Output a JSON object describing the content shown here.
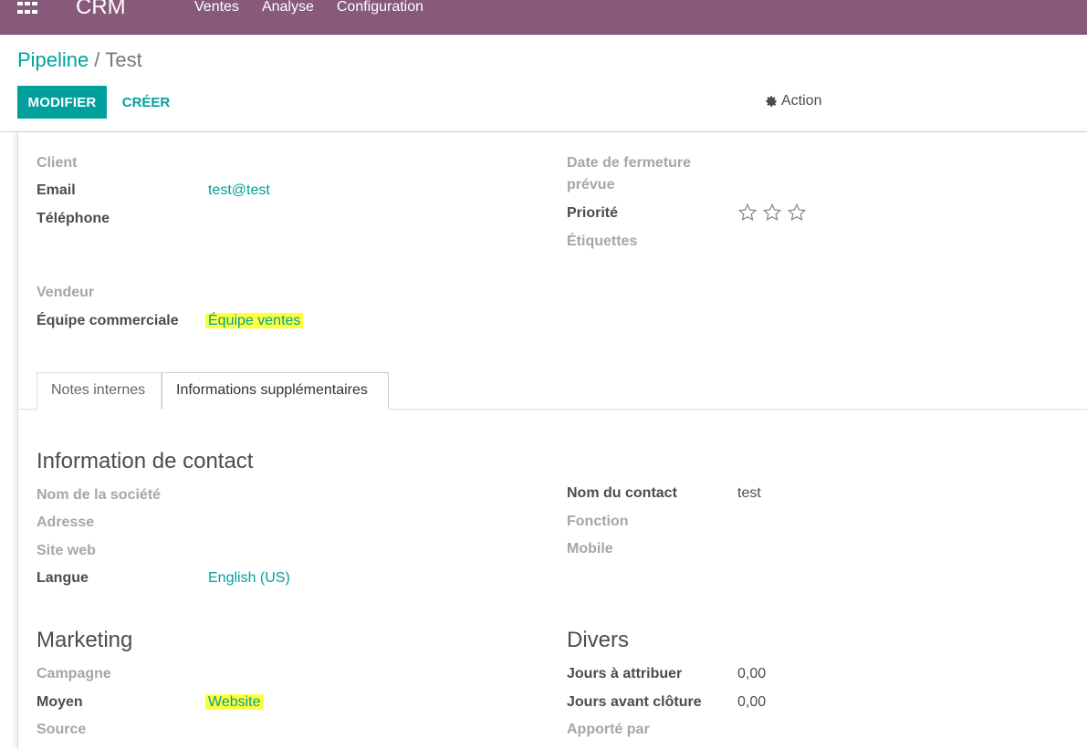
{
  "navbar": {
    "brand": "CRM",
    "menu": [
      "Ventes",
      "Analyse",
      "Configuration"
    ]
  },
  "breadcrumb": {
    "parent": "Pipeline",
    "separator": "/",
    "current": "Test"
  },
  "buttons": {
    "edit": "MODIFIER",
    "create": "CRÉER",
    "action": "Action"
  },
  "form": {
    "client_label": "Client",
    "email_label": "Email",
    "email_value": "test@test",
    "phone_label": "Téléphone",
    "close_date_label_1": "Date de fermeture",
    "close_date_label_2": "prévue",
    "priority_label": "Priorité",
    "priority_value": 0,
    "priority_max": 3,
    "tags_label": "Étiquettes",
    "salesperson_label": "Vendeur",
    "team_label": "Équipe commerciale",
    "team_value": "Équipe ventes"
  },
  "tabs": [
    {
      "label": "Notes internes",
      "active": false
    },
    {
      "label": "Informations supplémentaires",
      "active": true
    }
  ],
  "contact": {
    "title": "Information de contact",
    "company_label": "Nom de la société",
    "address_label": "Adresse",
    "website_label": "Site web",
    "language_label": "Langue",
    "language_value": "English (US)",
    "contact_name_label": "Nom du contact",
    "contact_name_value": "test",
    "function_label": "Fonction",
    "mobile_label": "Mobile"
  },
  "marketing": {
    "title": "Marketing",
    "campaign_label": "Campagne",
    "medium_label": "Moyen",
    "medium_value": "Website",
    "source_label": "Source"
  },
  "misc": {
    "title": "Divers",
    "days_assign_label": "Jours à attribuer",
    "days_assign_value": "0,00",
    "days_close_label": "Jours avant clôture",
    "days_close_value": "0,00",
    "referred_label": "Apporté par"
  },
  "colors": {
    "navbar": "#875a7b",
    "primary": "#00a09d",
    "highlight": "#ffff3a"
  }
}
